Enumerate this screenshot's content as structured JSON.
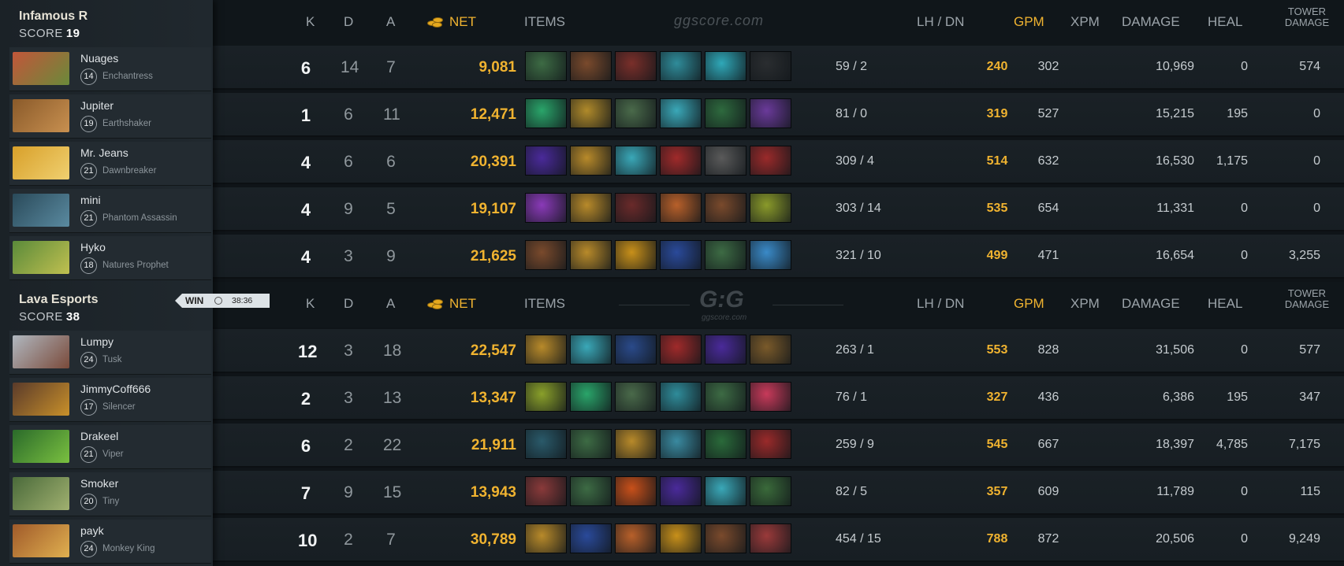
{
  "headers": {
    "k": "K",
    "d": "D",
    "a": "A",
    "net": "NET",
    "items": "ITEMS",
    "lh_dn": "LH  /  DN",
    "gpm": "GPM",
    "xpm": "XPM",
    "damage": "DAMAGE",
    "heal": "HEAL",
    "tower_1": "TOWER",
    "tower_2": "DAMAGE"
  },
  "watermark": "ggscore.com",
  "logo": {
    "mark": "G:G",
    "sub": "ggscore.com"
  },
  "win_badge": {
    "label": "WIN",
    "time": "38:36",
    "icon": "clock-icon"
  },
  "teams": [
    {
      "name": "Infamous R",
      "score_label": "SCORE",
      "score": "19",
      "players": [
        {
          "name": "Nuages",
          "level": "14",
          "hero": "Enchantress",
          "k": "6",
          "d": "14",
          "a": "7",
          "net": "9,081",
          "lh_dn": "59  /  2",
          "gpm": "240",
          "xpm": "302",
          "damage": "10,969",
          "heal": "0",
          "tower": "574",
          "portrait": [
            "#c2563a",
            "#6a8a3a"
          ],
          "items": [
            "#3d6b44",
            "#7a4a2c",
            "#7a2f2a",
            "#2f8c9a",
            "#2fa8b8",
            "#2a2d30"
          ]
        },
        {
          "name": "Jupiter",
          "level": "19",
          "hero": "Earthshaker",
          "k": "1",
          "d": "6",
          "a": "11",
          "net": "12,471",
          "lh_dn": "81  /  0",
          "gpm": "319",
          "xpm": "527",
          "damage": "15,215",
          "heal": "195",
          "tower": "0",
          "portrait": [
            "#8a5a2a",
            "#c89050"
          ],
          "items": [
            "#2aa56a",
            "#b08a2a",
            "#4a6a4a",
            "#3aa8b8",
            "#2e6a3e",
            "#6a3a9a"
          ]
        },
        {
          "name": "Mr. Jeans",
          "level": "21",
          "hero": "Dawnbreaker",
          "k": "4",
          "d": "6",
          "a": "6",
          "net": "20,391",
          "lh_dn": "309  /  4",
          "gpm": "514",
          "xpm": "632",
          "damage": "16,530",
          "heal": "1,175",
          "tower": "0",
          "portrait": [
            "#d8a02a",
            "#f0d070"
          ],
          "items": [
            "#4a2a9a",
            "#b88a2a",
            "#3aa8b8",
            "#a02a2a",
            "#5a5a5a",
            "#9a2a2a"
          ]
        },
        {
          "name": "mini",
          "level": "21",
          "hero": "Phantom Assassin",
          "k": "4",
          "d": "9",
          "a": "5",
          "net": "19,107",
          "lh_dn": "303  /  14",
          "gpm": "535",
          "xpm": "654",
          "damage": "11,331",
          "heal": "0",
          "tower": "0",
          "portrait": [
            "#2a4a5a",
            "#5a8aa0"
          ],
          "items": [
            "#8a3ab8",
            "#b88a2a",
            "#6a2a2a",
            "#b8602a",
            "#7a4a2c",
            "#8a9a2a"
          ]
        },
        {
          "name": "Hyko",
          "level": "18",
          "hero": "Natures Prophet",
          "k": "4",
          "d": "3",
          "a": "9",
          "net": "21,625",
          "lh_dn": "321  /  10",
          "gpm": "499",
          "xpm": "471",
          "damage": "16,654",
          "heal": "0",
          "tower": "3,255",
          "portrait": [
            "#5a8a3a",
            "#c0c050"
          ],
          "items": [
            "#7a4a2c",
            "#b88a2a",
            "#c8901a",
            "#2a4a9a",
            "#3d6b44",
            "#3a8ac8"
          ]
        }
      ]
    },
    {
      "name": "Lava Esports",
      "score_label": "SCORE",
      "score": "38",
      "players": [
        {
          "name": "Lumpy",
          "level": "24",
          "hero": "Tusk",
          "k": "12",
          "d": "3",
          "a": "18",
          "net": "22,547",
          "lh_dn": "263  /  1",
          "gpm": "553",
          "xpm": "828",
          "damage": "31,506",
          "heal": "0",
          "tower": "577",
          "portrait": [
            "#b0b8c0",
            "#7a4a3a"
          ],
          "items": [
            "#b88a2a",
            "#3aa8b8",
            "#2a4a8a",
            "#a02a2a",
            "#4a2a9a",
            "#7a5a2a"
          ]
        },
        {
          "name": "JimmyCoff666",
          "level": "17",
          "hero": "Silencer",
          "k": "2",
          "d": "3",
          "a": "13",
          "net": "13,347",
          "lh_dn": "76  /  1",
          "gpm": "327",
          "xpm": "436",
          "damage": "6,386",
          "heal": "195",
          "tower": "347",
          "portrait": [
            "#5a3a2a",
            "#c8902a"
          ],
          "items": [
            "#8aa02a",
            "#2aa56a",
            "#4a6a4a",
            "#2f8c9a",
            "#3d6b44",
            "#c83a5a"
          ]
        },
        {
          "name": "Drakeel",
          "level": "21",
          "hero": "Viper",
          "k": "6",
          "d": "2",
          "a": "22",
          "net": "21,911",
          "lh_dn": "259  /  9",
          "gpm": "545",
          "xpm": "667",
          "damage": "18,397",
          "heal": "4,785",
          "tower": "7,175",
          "portrait": [
            "#2a6a2a",
            "#7ac040"
          ],
          "items": [
            "#2a5a6a",
            "#3d6b44",
            "#b88a2a",
            "#3a8aa0",
            "#2a6a3a",
            "#9a2a2a"
          ]
        },
        {
          "name": "Smoker",
          "level": "20",
          "hero": "Tiny",
          "k": "7",
          "d": "9",
          "a": "15",
          "net": "13,943",
          "lh_dn": "82  /  5",
          "gpm": "357",
          "xpm": "609",
          "damage": "11,789",
          "heal": "0",
          "tower": "115",
          "portrait": [
            "#4a6a3a",
            "#a0b070"
          ],
          "items": [
            "#8a3a3a",
            "#3d6b44",
            "#c8501a",
            "#4a2a9a",
            "#3aa8b8",
            "#3a6a3a"
          ]
        },
        {
          "name": "payk",
          "level": "24",
          "hero": "Monkey King",
          "k": "10",
          "d": "2",
          "a": "7",
          "net": "30,789",
          "lh_dn": "454  /  15",
          "gpm": "788",
          "xpm": "872",
          "damage": "20,506",
          "heal": "0",
          "tower": "9,249",
          "portrait": [
            "#a05a2a",
            "#e0b050"
          ],
          "items": [
            "#b88a2a",
            "#2a4a9a",
            "#b8602a",
            "#c8901a",
            "#7a4a2c",
            "#9a3a3a"
          ]
        }
      ]
    }
  ]
}
